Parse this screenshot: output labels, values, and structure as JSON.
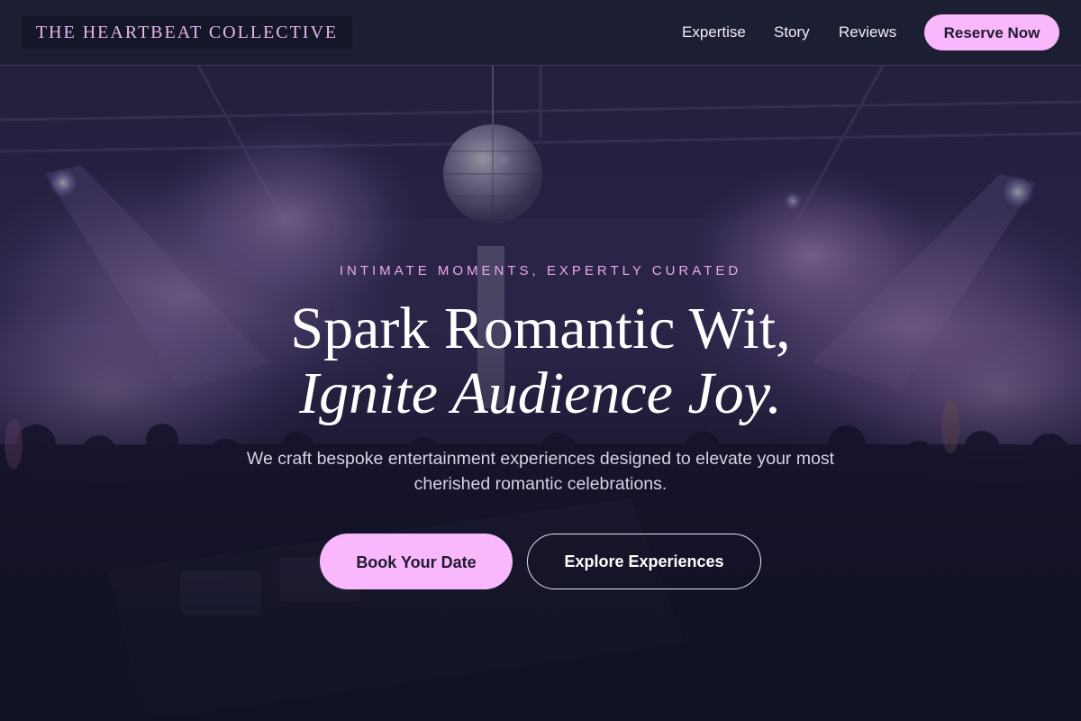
{
  "nav": {
    "logo": "THE HEARTBEAT COLLECTIVE",
    "links": [
      "Expertise",
      "Story",
      "Reviews"
    ],
    "cta": "Reserve Now"
  },
  "hero": {
    "eyebrow": "INTIMATE MOMENTS, EXPERTLY CURATED",
    "headline_line1": "Spark Romantic Wit,",
    "headline_line2": "Ignite Audience Joy.",
    "subtext": "We craft bespoke entertainment experiences designed to elevate your most cherished romantic celebrations.",
    "primary_button": "Book Your Date",
    "secondary_button": "Explore Experiences",
    "background_image": "nightclub-concert-crowd-with-disco-ball-and-fog"
  },
  "colors": {
    "accent": "#f9b8fc",
    "nav_bg": "#1c1f33",
    "eyebrow": "#e8a8ec",
    "logo_text": "#e8b4f0"
  }
}
